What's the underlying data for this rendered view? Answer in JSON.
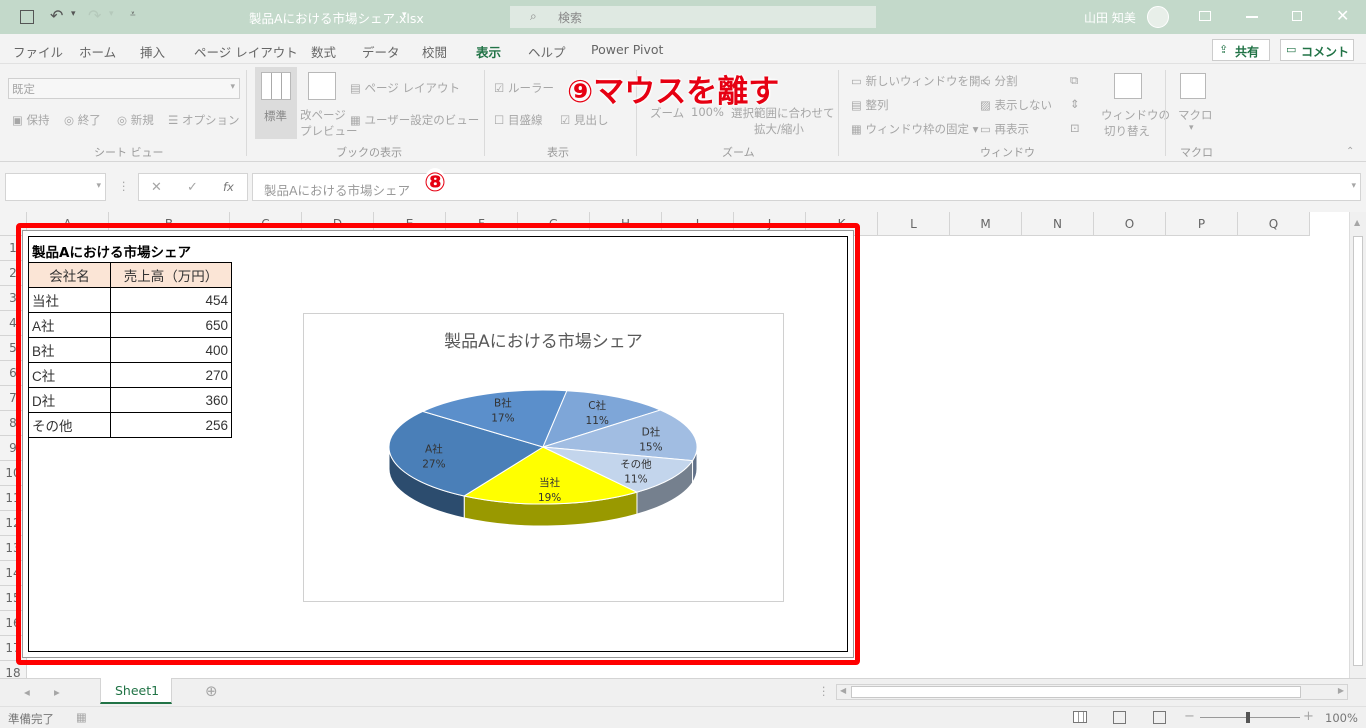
{
  "app": {
    "file_title": "製品Aにおける市場シェア.xlsx",
    "search_placeholder": "検索",
    "user_name": "山田 知美"
  },
  "tabs": [
    "ファイル",
    "ホーム",
    "挿入",
    "ページ レイアウト",
    "数式",
    "データ",
    "校閲",
    "表示",
    "ヘルプ",
    "Power Pivot"
  ],
  "share_label": "共有",
  "comment_label": "コメント",
  "ribbon": {
    "sheetview": {
      "dropdown": "既定",
      "keep": "保持",
      "exit": "終了",
      "new": "新規",
      "options": "オプション",
      "group": "シート ビュー"
    },
    "workbook": {
      "normal": "標準",
      "pagebreak": "改ページ\nプレビュー",
      "pagebreak1": "改ページ",
      "pagebreak2": "プレビュー",
      "pagelayout": "ページ レイアウト",
      "custom": "ユーザー設定のビュー",
      "group": "ブックの表示"
    },
    "show": {
      "ruler": "ルーラー",
      "gridlines": "目盛線",
      "headings": "見出し",
      "group": "表示"
    },
    "zoom": {
      "zoom": "ズーム",
      "hundred": "100%",
      "fit1": "選択範囲に合わせて",
      "fit2": "拡大/縮小",
      "group": "ズーム"
    },
    "window": {
      "newwin": "新しいウィンドウを開く",
      "arrange": "整列",
      "freeze": "ウィンドウ枠の固定",
      "split": "分割",
      "hide": "表示しない",
      "unhide": "再表示",
      "switch1": "ウィンドウの",
      "switch2": "切り替え",
      "group": "ウィンドウ"
    },
    "macro": {
      "label": "マクロ",
      "group": "マクロ"
    }
  },
  "formula_bar": {
    "fx": "fx",
    "content": "製品Aにおける市場シェア"
  },
  "columns": [
    "A",
    "B",
    "C",
    "D",
    "E",
    "F",
    "G",
    "H",
    "I",
    "J",
    "K",
    "L",
    "M",
    "N",
    "O",
    "P",
    "Q"
  ],
  "rows": [
    "1",
    "2",
    "3",
    "4",
    "5",
    "6",
    "7",
    "8",
    "9",
    "10",
    "11",
    "12",
    "13",
    "14",
    "15",
    "16",
    "17",
    "18"
  ],
  "table": {
    "title": "製品Aにおける市場シェア",
    "headers": [
      "会社名",
      "売上高（万円）"
    ],
    "rows": [
      [
        "当社",
        "454"
      ],
      [
        "A社",
        "650"
      ],
      [
        "B社",
        "400"
      ],
      [
        "C社",
        "270"
      ],
      [
        "D社",
        "360"
      ],
      [
        "その他",
        "256"
      ]
    ]
  },
  "chart_data": {
    "type": "pie",
    "title": "製品Aにおける市場シェア",
    "categories": [
      "当社",
      "A社",
      "B社",
      "C社",
      "D社",
      "その他"
    ],
    "values": [
      454,
      650,
      400,
      270,
      360,
      256
    ],
    "percent_labels": [
      "19%",
      "27%",
      "17%",
      "11%",
      "15%",
      "11%"
    ],
    "colors": [
      "#ffff00",
      "#4a7fb8",
      "#5b8fcb",
      "#7ea6d8",
      "#a1bde2",
      "#c3d5ec"
    ],
    "style": "3d",
    "legend": "none"
  },
  "annotations": {
    "step8": "⑧",
    "step9": "⑨マウスを離す"
  },
  "sheet_tab": "Sheet1",
  "status": {
    "ready": "準備完了",
    "zoom": "100%"
  },
  "colors": {
    "accent": "#217346",
    "highlight": "#e60012"
  }
}
